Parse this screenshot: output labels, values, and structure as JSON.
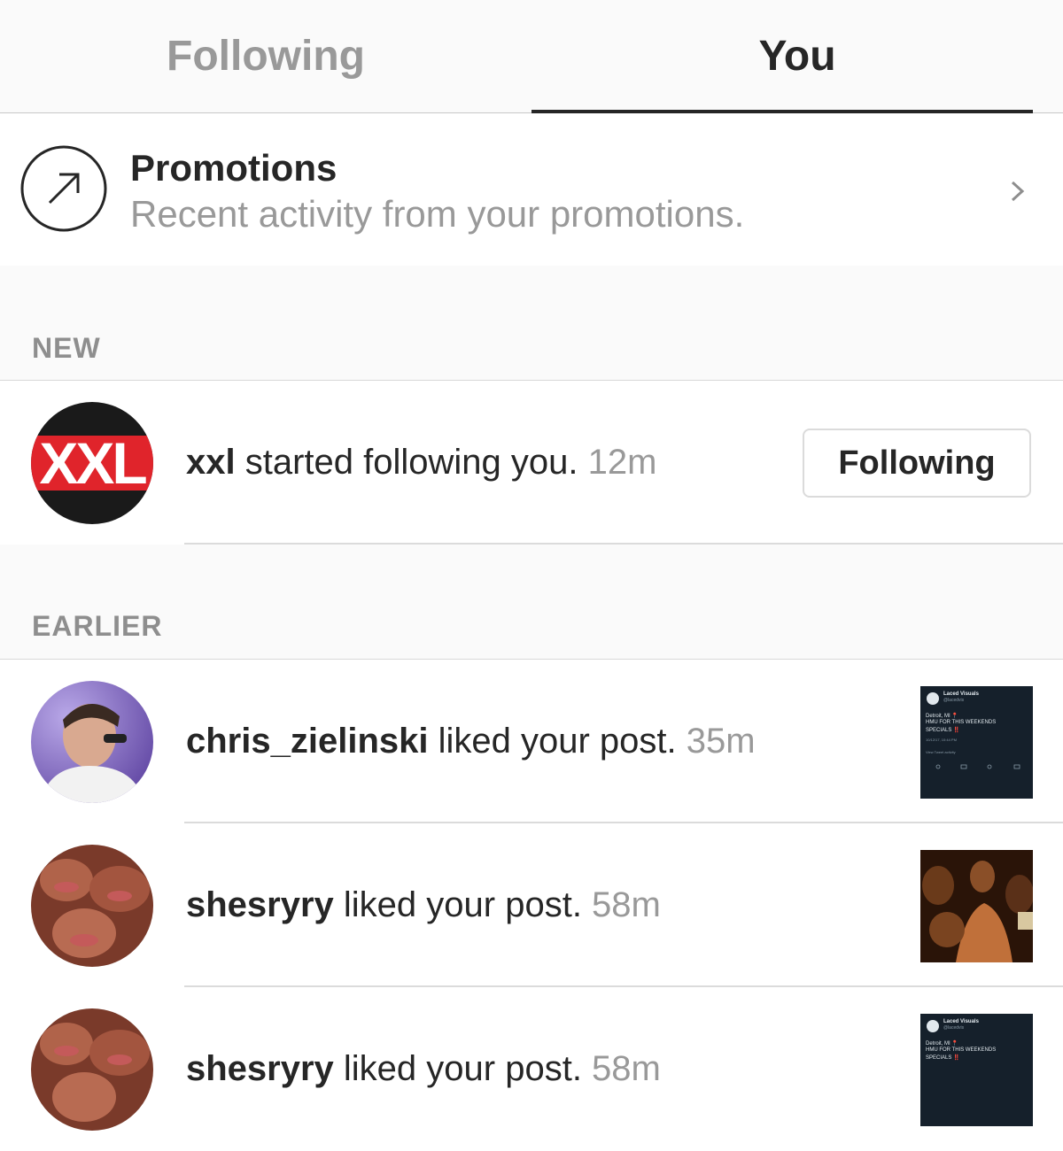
{
  "tabs": [
    {
      "label": "Following",
      "active": false
    },
    {
      "label": "You",
      "active": true
    }
  ],
  "promotions": {
    "title": "Promotions",
    "subtitle": "Recent activity from your promotions.",
    "icon": "arrow-up-right-icon"
  },
  "sections": {
    "new_label": "NEW",
    "earlier_label": "EARLIER"
  },
  "new_items": [
    {
      "username": "xxl",
      "action": " started following you. ",
      "time": "12m",
      "avatar_text": "XXL",
      "button_label": "Following"
    }
  ],
  "earlier_items": [
    {
      "username": "chris_zielinski",
      "action": " liked your post. ",
      "time": "35m"
    },
    {
      "username": "shesryry",
      "action": " liked your post. ",
      "time": "58m"
    },
    {
      "username": "shesryry",
      "action": " liked your post. ",
      "time": "58m"
    }
  ],
  "tweet_thumb": {
    "name": "Laced Visuals",
    "handle": "@lacedvis",
    "line1": "Detroit, MI 📍",
    "line2": "HMU FOR THIS WEEKENDS",
    "line3": "SPECIALS ‼️",
    "date": "10/12/17, 10:44 PM",
    "activity": "View Tweet activity"
  },
  "colors": {
    "text_primary": "#262626",
    "text_secondary": "#999999",
    "background": "#fafafa",
    "divider": "#dbdbdb",
    "xxl_red": "#e0242b"
  }
}
